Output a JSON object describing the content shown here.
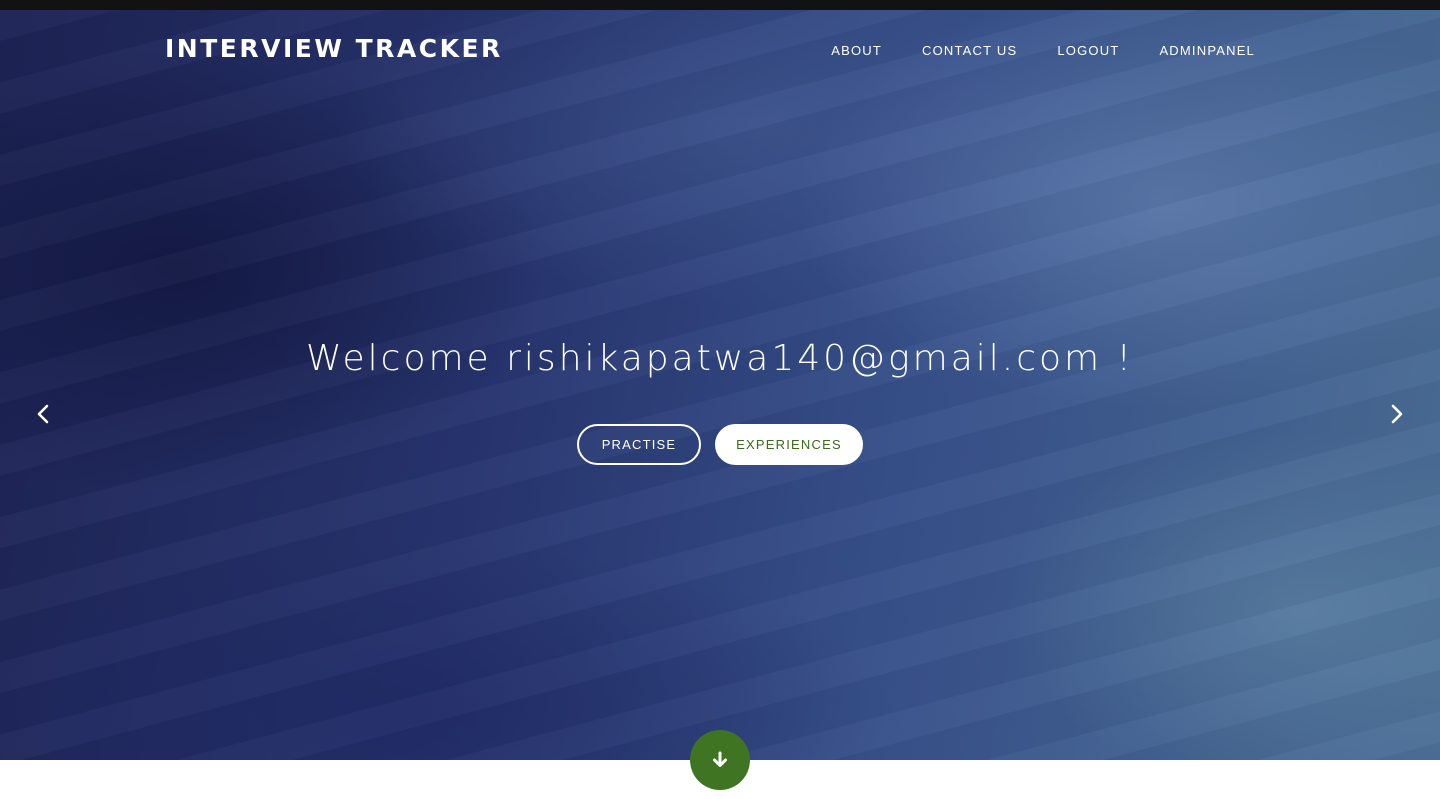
{
  "header": {
    "brand": "INTERVIEW TRACKER",
    "nav": [
      {
        "label": "ABOUT"
      },
      {
        "label": "CONTACT US"
      },
      {
        "label": "LOGOUT"
      },
      {
        "label": "ADMINPANEL"
      }
    ]
  },
  "hero": {
    "welcome": "Welcome rishikapatwa140@gmail.com !",
    "buttons": {
      "practise": "PRACTISE",
      "experiences": "EXPERIENCES"
    },
    "prev_icon": "chevron-left-icon",
    "next_icon": "chevron-right-icon"
  },
  "scroll_button": {
    "icon": "arrow-down-icon"
  },
  "colors": {
    "accent_green": "#3f7422",
    "button_text_green": "#3b6b18",
    "hero_dark": "#1d2354",
    "hero_light": "#4b6e96"
  }
}
